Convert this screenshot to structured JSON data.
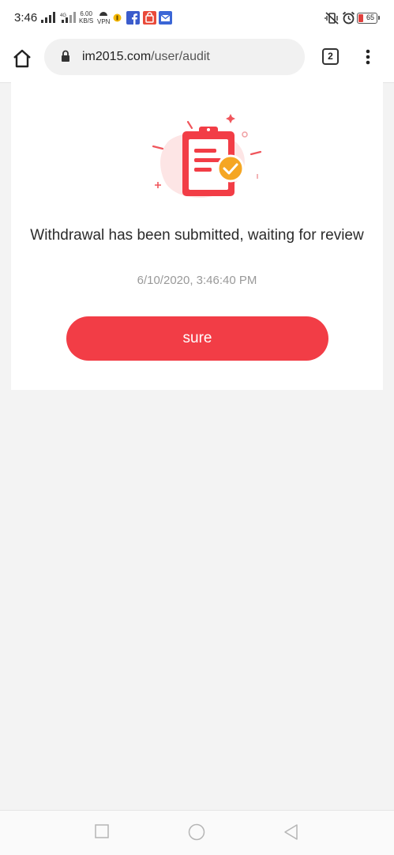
{
  "status_bar": {
    "time": "3:46",
    "net_speed_value": "6.00",
    "net_speed_unit": "KB/S",
    "vpn_label": "VPN",
    "battery_level": "65",
    "icons": [
      "signal-icon",
      "signal-4g-icon",
      "vpn-icon",
      "notification-icon",
      "facebook-icon",
      "shopping-bag-icon",
      "mail-icon",
      "vibrate-icon",
      "alarm-icon",
      "battery-icon"
    ]
  },
  "browser": {
    "url_domain": "im2015.com",
    "url_path": "/user/audit",
    "tab_count": "2"
  },
  "audit": {
    "message": "Withdrawal has been submitted, waiting for review",
    "timestamp": "6/10/2020, 3:46:40 PM",
    "confirm_label": "sure"
  },
  "colors": {
    "accent": "#f23d46",
    "check_badge": "#f5a623",
    "page_background": "#f3f3f3",
    "card_background": "#ffffff",
    "timestamp_text": "#999999"
  }
}
